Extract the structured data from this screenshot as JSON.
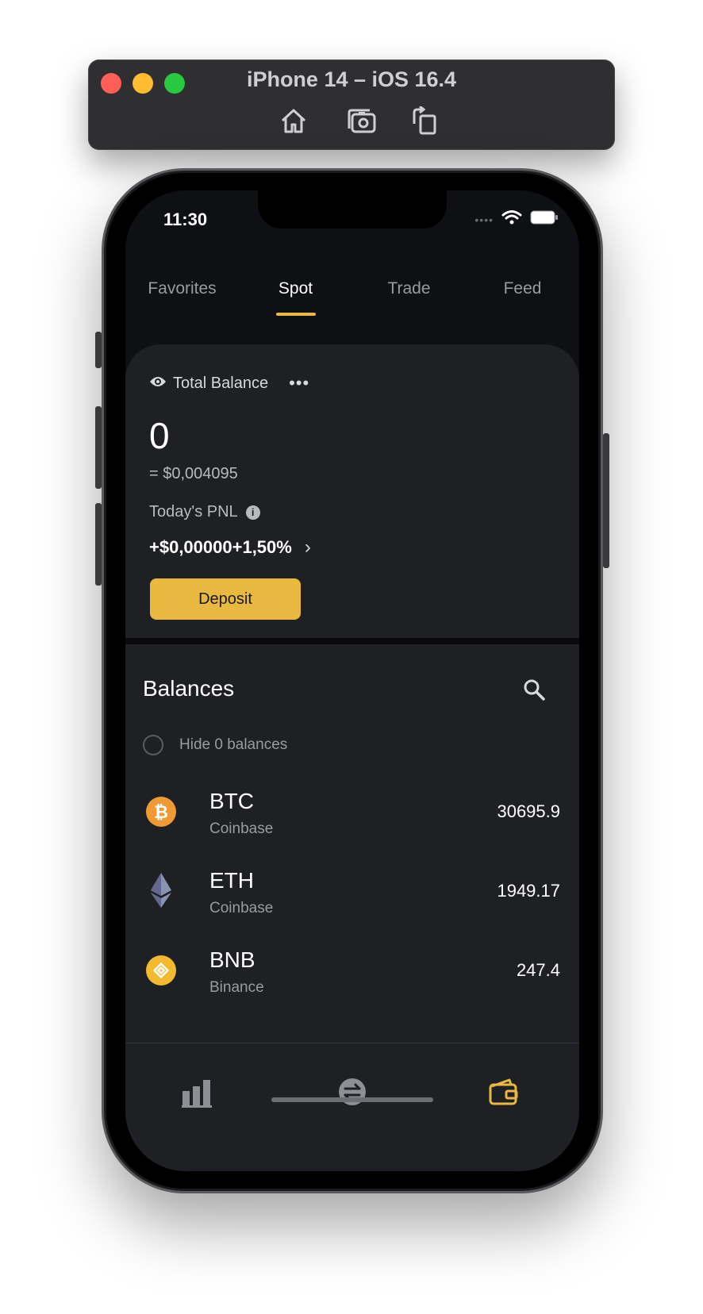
{
  "simulator": {
    "title": "iPhone 14 – iOS 16.4",
    "tools": [
      "home-icon",
      "screenshot-icon",
      "rotate-icon"
    ]
  },
  "status_bar": {
    "time": "11:30"
  },
  "tabs": [
    {
      "label": "Favorites",
      "active": false
    },
    {
      "label": "Spot",
      "active": true
    },
    {
      "label": "Trade",
      "active": false
    },
    {
      "label": "Feed",
      "active": false
    }
  ],
  "balance_card": {
    "label": "Total Balance",
    "more": "•••",
    "amount": "0",
    "usd_equiv": "= $0,004095",
    "pnl_label": "Today's PNL",
    "pnl_value": "+$0,00000+1,50%",
    "deposit_label": "Deposit"
  },
  "balances": {
    "title": "Balances",
    "hide_zero_label": "Hide 0 balances",
    "assets": [
      {
        "symbol": "BTC",
        "exchange": "Coinbase",
        "value": "30695.9",
        "icon": "bitcoin-icon",
        "color": "#f09a36"
      },
      {
        "symbol": "ETH",
        "exchange": "Coinbase",
        "value": "1949.17",
        "icon": "ethereum-icon",
        "color": "#8a92b2"
      },
      {
        "symbol": "BNB",
        "exchange": "Binance",
        "value": "247.4",
        "icon": "bnb-icon",
        "color": "#f3ba2f"
      }
    ]
  },
  "bottom_nav": [
    {
      "icon": "markets-chart-icon",
      "active": false
    },
    {
      "icon": "swap-icon",
      "active": false
    },
    {
      "icon": "wallet-icon",
      "active": true
    }
  ],
  "colors": {
    "accent": "#e8b83f",
    "background": "#0f1013",
    "card": "#1f2024",
    "muted_text": "#9a9ba0"
  }
}
